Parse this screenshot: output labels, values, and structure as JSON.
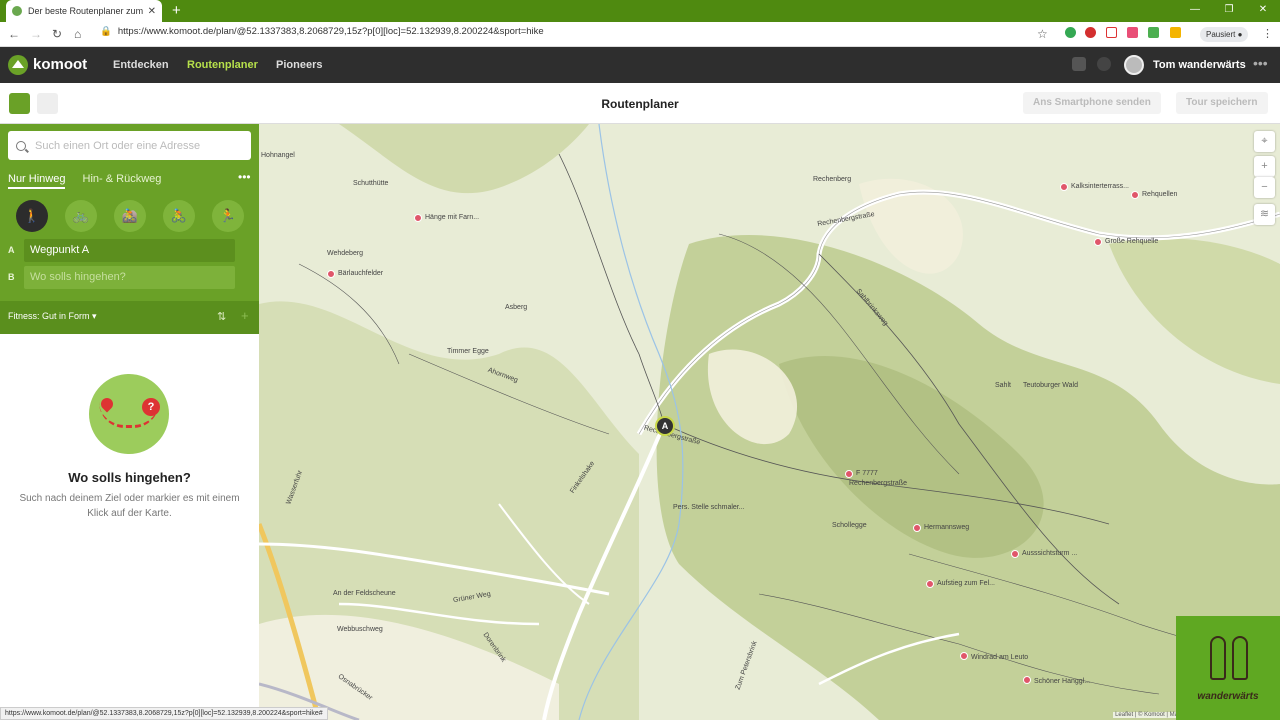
{
  "browser": {
    "tab_title": "Der beste Routenplaner zum Ra",
    "url": "https://www.komoot.de/plan/@52.1337383,8.2068729,15z?p[0][loc]=52.132939,8.200224&sport=hike",
    "paused_label": "Pausiert",
    "status_url": "https://www.komoot.de/plan/@52.1337383,8.2068729,15z?p[0][loc]=52.132939,8.200224&sport=hike#"
  },
  "header": {
    "brand": "komoot",
    "nav": [
      "Entdecken",
      "Routenplaner",
      "Pioneers"
    ],
    "active_nav": "Routenplaner",
    "user": "Tom wanderwärts",
    "more": "•••"
  },
  "subheader": {
    "title": "Routenplaner",
    "send_button": "Ans Smartphone senden",
    "save_button": "Tour speichern"
  },
  "sidebar": {
    "search_placeholder": "Such einen Ort oder eine Adresse",
    "tabs": [
      "Nur Hinweg",
      "Hin- & Rückweg"
    ],
    "more": "•••",
    "sports": [
      "hike-icon",
      "bike-icon",
      "mountainbike-icon",
      "roadbike-icon",
      "run-icon"
    ],
    "waypoint_a_label": "A",
    "waypoint_a_value": "Wegpunkt A",
    "waypoint_b_label": "B",
    "waypoint_b_placeholder": "Wo solls hingehen?",
    "fitness": "Fitness: Gut in Form ▾",
    "empty_title": "Wo solls hingehen?",
    "empty_desc": "Such nach deinem Ziel oder markier es mit einem Klick auf der Karte."
  },
  "map": {
    "waypoint_marker": "A",
    "labels": [
      "Hohnangel",
      "Schutthütte",
      "Hänge mit Farn...",
      "Rechenberg",
      "Kalksinterterrass...",
      "Rehquellen",
      "Rechenbergstraße",
      "Große Rehquelle",
      "Wehdeberg",
      "Bärlauchfelder",
      "Asberg",
      "Timmer Egge",
      "Ahornweg",
      "Sahlbrinksweg",
      "Sahlt",
      "Teutoburger Wald",
      "F 7777",
      "Rechenbergstraße",
      "Pers. Stelle schmaler...",
      "Schollegge",
      "Hermannsweg",
      "Ausssichtsturm ...",
      "Aufstieg zum Fel...",
      "Rechenbergstraße",
      "Finkelshake",
      "Grüner Weg",
      "An der Feldscheune",
      "Webbuschweg",
      "Dorenbrink",
      "Zum Petersbrink",
      "Windrad am Leuto",
      "Schöner Hanggl...",
      "Wasserfuhr",
      "Osnabrücker"
    ],
    "attribution": "Leaflet | © Komoot | Ma"
  },
  "logo_overlay": {
    "text": "wanderwärts"
  },
  "colors": {
    "komoot_green": "#6aa127",
    "header_dark": "#2e2e2e",
    "active_nav": "#b6e04b",
    "poi": "#e0566a"
  }
}
